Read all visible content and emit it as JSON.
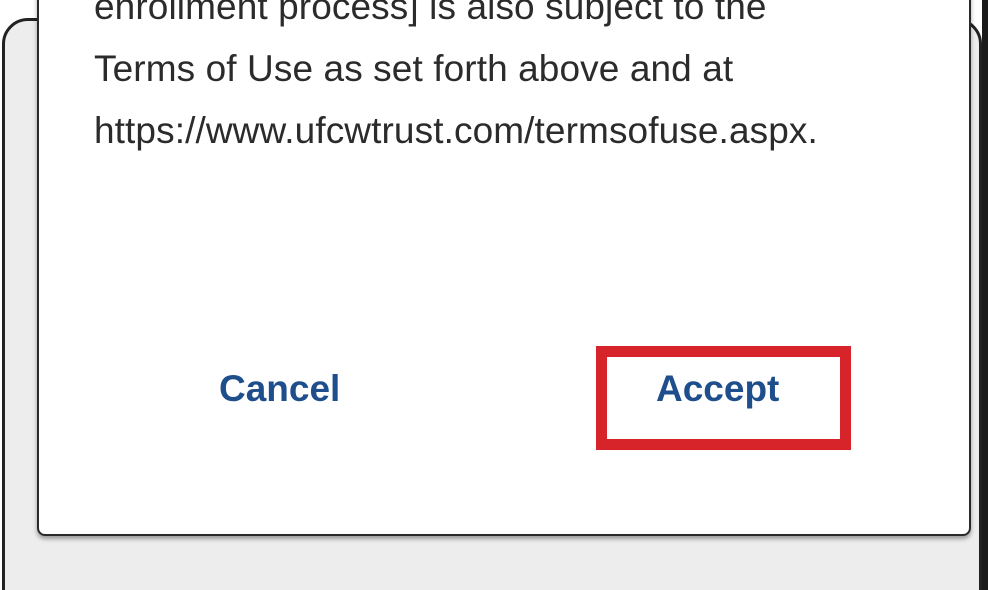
{
  "dialog": {
    "text_lines": [
      "enrollment process] is also subject to the",
      "Terms of Use as set forth above and at",
      "https://www.ufcwtrust.com/termsofuse.aspx."
    ],
    "cancel_label": "Cancel",
    "accept_label": "Accept"
  },
  "colors": {
    "button_text": "#1f4e8c",
    "highlight": "#d7242a",
    "body_text": "#2b2b2b"
  }
}
